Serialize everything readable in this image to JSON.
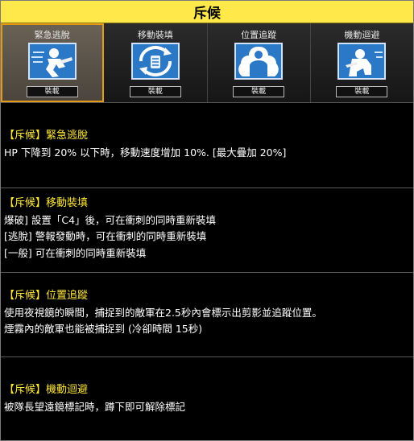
{
  "title": "斥候",
  "skills": [
    {
      "name": "緊急逃脫",
      "button": "裝載",
      "icon": "running-soldier-icon"
    },
    {
      "name": "移動裝填",
      "button": "裝載",
      "icon": "reload-arrows-icon"
    },
    {
      "name": "位置追蹤",
      "button": "裝載",
      "icon": "tracked-soldier-icon"
    },
    {
      "name": "機動迴避",
      "button": "裝載",
      "icon": "crouching-soldier-icon"
    }
  ],
  "descriptions": [
    {
      "heading": "【斥候】緊急逃脫",
      "lines": [
        "HP 下降到 20% 以下時，移動速度增加 10%. [最大疊加 20%]"
      ]
    },
    {
      "heading": "【斥候】移動裝填",
      "lines": [
        "爆破] 設置「C4」後，可在衝刺的同時重新裝填",
        "[逃脫] 警報發動時，可在衝刺的同時重新裝填",
        "[一般] 可在衝刺的同時重新裝填"
      ]
    },
    {
      "heading": "【斥候】位置追蹤",
      "lines": [
        "使用夜視鏡的瞬間，捕捉到的敵軍在2.5秒內會標示出剪影並追蹤位置。",
        "煙霧內的敵軍也能被捕捉到 (冷卻時間 15秒)"
      ]
    },
    {
      "heading": "【斥候】機動迴避",
      "lines": [
        "被隊長望遠鏡標記時，蹲下即可解除標記"
      ]
    }
  ]
}
